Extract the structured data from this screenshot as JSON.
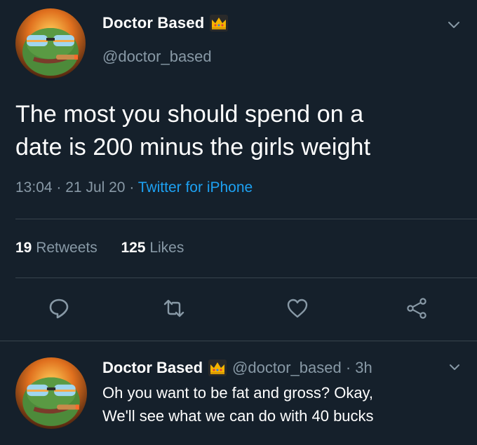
{
  "tweet": {
    "display_name": "Doctor Based",
    "handle": "@doctor_based",
    "text_line1": "The most you should spend on a",
    "text_line2": "date is 200 minus the girls weight",
    "time": "13:04",
    "separator": "·",
    "date": "21 Jul 20",
    "source": "Twitter for iPhone",
    "retweet_count": "19",
    "retweet_label": "Retweets",
    "like_count": "125",
    "like_label": "Likes"
  },
  "reply": {
    "display_name": "Doctor Based",
    "handle": "@doctor_based",
    "separator": "·",
    "time": "3h",
    "text_line1": "Oh you want to be fat and gross? Okay,",
    "text_line2": "We'll see what we can do with 40 bucks"
  },
  "icons": {
    "badge": "crown-icon",
    "menu": "chevron-down-icon",
    "reply": "reply-icon",
    "retweet": "retweet-icon",
    "like": "heart-icon",
    "share": "share-icon"
  },
  "colors": {
    "background": "#15202b",
    "text_primary": "#ffffff",
    "text_secondary": "#8899a6",
    "accent": "#1da1f2",
    "divider": "#38444d",
    "crown": "#f5b400"
  }
}
